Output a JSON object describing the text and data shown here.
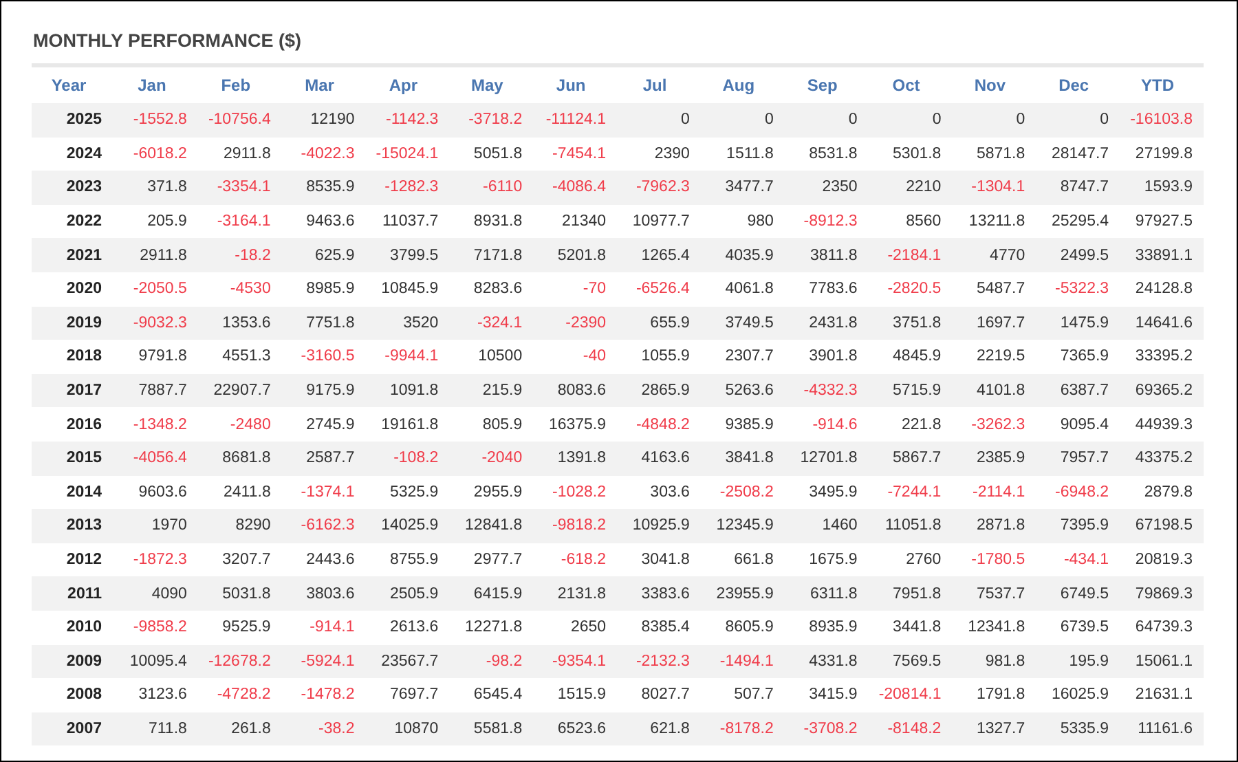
{
  "title": "MONTHLY PERFORMANCE ($)",
  "table": {
    "columns": [
      "Year",
      "Jan",
      "Feb",
      "Mar",
      "Apr",
      "May",
      "Jun",
      "Jul",
      "Aug",
      "Sep",
      "Oct",
      "Nov",
      "Dec",
      "YTD"
    ],
    "rows": [
      {
        "year": "2025",
        "values": [
          "-1552.8",
          "-10756.4",
          "12190",
          "-1142.3",
          "-3718.2",
          "-11124.1",
          "0",
          "0",
          "0",
          "0",
          "0",
          "0",
          "-16103.8"
        ],
        "negative": [
          true,
          true,
          false,
          true,
          true,
          true,
          false,
          false,
          false,
          false,
          false,
          false,
          true
        ]
      },
      {
        "year": "2024",
        "values": [
          "-6018.2",
          "2911.8",
          "-4022.3",
          "-15024.1",
          "5051.8",
          "-7454.1",
          "2390",
          "1511.8",
          "8531.8",
          "5301.8",
          "5871.8",
          "28147.7",
          "27199.8"
        ],
        "negative": [
          true,
          false,
          true,
          true,
          false,
          true,
          false,
          false,
          false,
          false,
          false,
          false,
          false
        ]
      },
      {
        "year": "2023",
        "values": [
          "371.8",
          "-3354.1",
          "8535.9",
          "-1282.3",
          "-6110",
          "-4086.4",
          "-7962.3",
          "3477.7",
          "2350",
          "2210",
          "-1304.1",
          "8747.7",
          "1593.9"
        ],
        "negative": [
          false,
          true,
          false,
          true,
          true,
          true,
          true,
          false,
          false,
          false,
          true,
          false,
          false
        ]
      },
      {
        "year": "2022",
        "values": [
          "205.9",
          "-3164.1",
          "9463.6",
          "11037.7",
          "8931.8",
          "21340",
          "10977.7",
          "980",
          "-8912.3",
          "8560",
          "13211.8",
          "25295.4",
          "97927.5"
        ],
        "negative": [
          false,
          true,
          false,
          false,
          false,
          false,
          false,
          false,
          true,
          false,
          false,
          false,
          false
        ]
      },
      {
        "year": "2021",
        "values": [
          "2911.8",
          "-18.2",
          "625.9",
          "3799.5",
          "7171.8",
          "5201.8",
          "1265.4",
          "4035.9",
          "3811.8",
          "-2184.1",
          "4770",
          "2499.5",
          "33891.1"
        ],
        "negative": [
          false,
          true,
          false,
          false,
          false,
          false,
          false,
          false,
          false,
          true,
          false,
          false,
          false
        ]
      },
      {
        "year": "2020",
        "values": [
          "-2050.5",
          "-4530",
          "8985.9",
          "10845.9",
          "8283.6",
          "-70",
          "-6526.4",
          "4061.8",
          "7783.6",
          "-2820.5",
          "5487.7",
          "-5322.3",
          "24128.8"
        ],
        "negative": [
          true,
          true,
          false,
          false,
          false,
          true,
          true,
          false,
          false,
          true,
          false,
          true,
          false
        ]
      },
      {
        "year": "2019",
        "values": [
          "-9032.3",
          "1353.6",
          "7751.8",
          "3520",
          "-324.1",
          "-2390",
          "655.9",
          "3749.5",
          "2431.8",
          "3751.8",
          "1697.7",
          "1475.9",
          "14641.6"
        ],
        "negative": [
          true,
          false,
          false,
          false,
          true,
          true,
          false,
          false,
          false,
          false,
          false,
          false,
          false
        ]
      },
      {
        "year": "2018",
        "values": [
          "9791.8",
          "4551.3",
          "-3160.5",
          "-9944.1",
          "10500",
          "-40",
          "1055.9",
          "2307.7",
          "3901.8",
          "4845.9",
          "2219.5",
          "7365.9",
          "33395.2"
        ],
        "negative": [
          false,
          false,
          true,
          true,
          false,
          true,
          false,
          false,
          false,
          false,
          false,
          false,
          false
        ]
      },
      {
        "year": "2017",
        "values": [
          "7887.7",
          "22907.7",
          "9175.9",
          "1091.8",
          "215.9",
          "8083.6",
          "2865.9",
          "5263.6",
          "-4332.3",
          "5715.9",
          "4101.8",
          "6387.7",
          "69365.2"
        ],
        "negative": [
          false,
          false,
          false,
          false,
          false,
          false,
          false,
          false,
          true,
          false,
          false,
          false,
          false
        ]
      },
      {
        "year": "2016",
        "values": [
          "-1348.2",
          "-2480",
          "2745.9",
          "19161.8",
          "805.9",
          "16375.9",
          "-4848.2",
          "9385.9",
          "-914.6",
          "221.8",
          "-3262.3",
          "9095.4",
          "44939.3"
        ],
        "negative": [
          true,
          true,
          false,
          false,
          false,
          false,
          true,
          false,
          true,
          false,
          true,
          false,
          false
        ]
      },
      {
        "year": "2015",
        "values": [
          "-4056.4",
          "8681.8",
          "2587.7",
          "-108.2",
          "-2040",
          "1391.8",
          "4163.6",
          "3841.8",
          "12701.8",
          "5867.7",
          "2385.9",
          "7957.7",
          "43375.2"
        ],
        "negative": [
          true,
          false,
          false,
          true,
          true,
          false,
          false,
          false,
          false,
          false,
          false,
          false,
          false
        ]
      },
      {
        "year": "2014",
        "values": [
          "9603.6",
          "2411.8",
          "-1374.1",
          "5325.9",
          "2955.9",
          "-1028.2",
          "303.6",
          "-2508.2",
          "3495.9",
          "-7244.1",
          "-2114.1",
          "-6948.2",
          "2879.8"
        ],
        "negative": [
          false,
          false,
          true,
          false,
          false,
          true,
          false,
          true,
          false,
          true,
          true,
          true,
          false
        ]
      },
      {
        "year": "2013",
        "values": [
          "1970",
          "8290",
          "-6162.3",
          "14025.9",
          "12841.8",
          "-9818.2",
          "10925.9",
          "12345.9",
          "1460",
          "11051.8",
          "2871.8",
          "7395.9",
          "67198.5"
        ],
        "negative": [
          false,
          false,
          true,
          false,
          false,
          true,
          false,
          false,
          false,
          false,
          false,
          false,
          false
        ]
      },
      {
        "year": "2012",
        "values": [
          "-1872.3",
          "3207.7",
          "2443.6",
          "8755.9",
          "2977.7",
          "-618.2",
          "3041.8",
          "661.8",
          "1675.9",
          "2760",
          "-1780.5",
          "-434.1",
          "20819.3"
        ],
        "negative": [
          true,
          false,
          false,
          false,
          false,
          true,
          false,
          false,
          false,
          false,
          true,
          true,
          false
        ]
      },
      {
        "year": "2011",
        "values": [
          "4090",
          "5031.8",
          "3803.6",
          "2505.9",
          "6415.9",
          "2131.8",
          "3383.6",
          "23955.9",
          "6311.8",
          "7951.8",
          "7537.7",
          "6749.5",
          "79869.3"
        ],
        "negative": [
          false,
          false,
          false,
          false,
          false,
          false,
          false,
          false,
          false,
          false,
          false,
          false,
          false
        ]
      },
      {
        "year": "2010",
        "values": [
          "-9858.2",
          "9525.9",
          "-914.1",
          "2613.6",
          "12271.8",
          "2650",
          "8385.4",
          "8605.9",
          "8935.9",
          "3441.8",
          "12341.8",
          "6739.5",
          "64739.3"
        ],
        "negative": [
          true,
          false,
          true,
          false,
          false,
          false,
          false,
          false,
          false,
          false,
          false,
          false,
          false
        ]
      },
      {
        "year": "2009",
        "values": [
          "10095.4",
          "-12678.2",
          "-5924.1",
          "23567.7",
          "-98.2",
          "-9354.1",
          "-2132.3",
          "-1494.1",
          "4331.8",
          "7569.5",
          "981.8",
          "195.9",
          "15061.1"
        ],
        "negative": [
          false,
          true,
          true,
          false,
          true,
          true,
          true,
          true,
          false,
          false,
          false,
          false,
          false
        ]
      },
      {
        "year": "2008",
        "values": [
          "3123.6",
          "-4728.2",
          "-1478.2",
          "7697.7",
          "6545.4",
          "1515.9",
          "8027.7",
          "507.7",
          "3415.9",
          "-20814.1",
          "1791.8",
          "16025.9",
          "21631.1"
        ],
        "negative": [
          false,
          true,
          true,
          false,
          false,
          false,
          false,
          false,
          false,
          true,
          false,
          false,
          false
        ]
      },
      {
        "year": "2007",
        "values": [
          "711.8",
          "261.8",
          "-38.2",
          "10870",
          "5581.8",
          "6523.6",
          "621.8",
          "-8178.2",
          "-3708.2",
          "-8148.2",
          "1327.7",
          "5335.9",
          "11161.6"
        ],
        "negative": [
          false,
          false,
          true,
          false,
          false,
          false,
          false,
          true,
          true,
          true,
          false,
          false,
          false
        ]
      }
    ]
  }
}
